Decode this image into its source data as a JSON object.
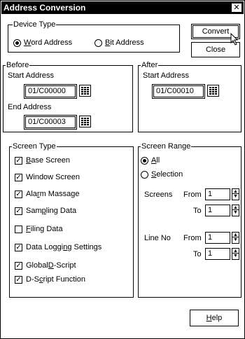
{
  "window": {
    "title": "Address Conversion",
    "close_glyph": "✕"
  },
  "device_type": {
    "title": "Device Type",
    "word_prefix": "",
    "word_accel": "W",
    "word_rest": "ord Address",
    "bit_accel": "B",
    "bit_rest": "it Address",
    "selected": "word"
  },
  "buttons": {
    "convert": "Convert",
    "close": "Close",
    "help_accel": "H",
    "help_rest": "elp"
  },
  "before": {
    "title": "Before",
    "start_label": "Start Address",
    "start_value": "01/C00000",
    "end_label": "End Address",
    "end_value": "01/C00003"
  },
  "after": {
    "title": "After",
    "start_label": "Start Address",
    "start_value": "01/C00010"
  },
  "screen_type": {
    "title": "Screen Type",
    "items": [
      {
        "pre": "",
        "accel": "B",
        "post": "ase Screen",
        "checked": true
      },
      {
        "pre": "Window Screen",
        "accel": "",
        "post": "",
        "checked": true
      },
      {
        "pre": "Ala",
        "accel": "r",
        "post": "m Massage",
        "checked": true
      },
      {
        "pre": "Sam",
        "accel": "p",
        "post": "ling Data",
        "checked": true
      },
      {
        "pre": "",
        "accel": "F",
        "post": "iling Data",
        "checked": false
      },
      {
        "pre": "Data Loggi",
        "accel": "n",
        "post": "g Settings",
        "checked": true
      },
      {
        "pre": "Global ",
        "accel": "D",
        "post": "-Script",
        "checked": true
      },
      {
        "pre": "D-S",
        "accel": "c",
        "post": "ript Function",
        "checked": true
      }
    ]
  },
  "screen_range": {
    "title": "Screen Range",
    "all_accel": "A",
    "all_rest": "ll",
    "sel_accel": "S",
    "sel_rest": "election",
    "selected": "all",
    "screens_label": "Screens",
    "from_label": "From",
    "to_label": "To",
    "screens_from": "1",
    "screens_to": "1",
    "lineno_label": "Line No",
    "line_from": "1",
    "line_to": "1"
  },
  "icons": {
    "keypad": "keypad-icon",
    "spin": "spin-arrows-icon",
    "cursor": "mouse-cursor-icon"
  }
}
